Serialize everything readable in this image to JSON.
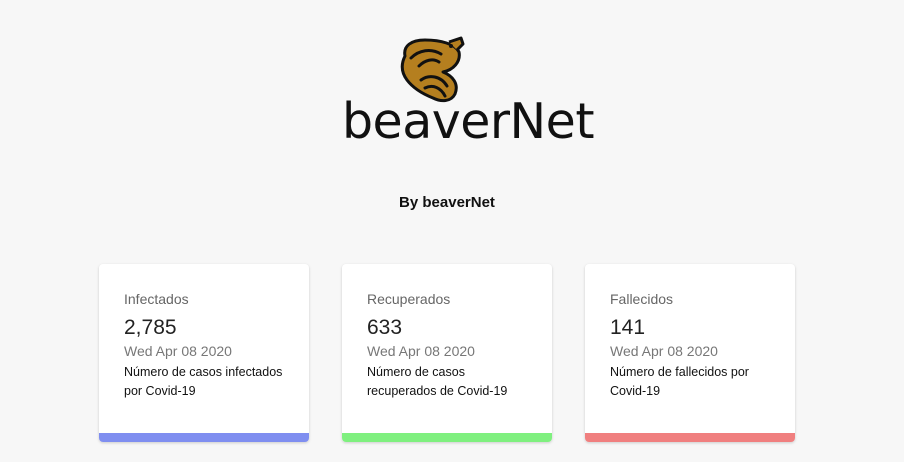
{
  "brand": {
    "title": "beaverNet",
    "byline": "By beaverNet",
    "logo_icon": "beaver-logo-icon",
    "logo_color": "#b57f1f"
  },
  "cards": [
    {
      "label": "Infectados",
      "value": "2,785",
      "date": "Wed Apr 08 2020",
      "description": "Número de casos infectados por Covid-19",
      "color": "#7f8ef0"
    },
    {
      "label": "Recuperados",
      "value": "633",
      "date": "Wed Apr 08 2020",
      "description": "Número de casos recuperados de Covid-19",
      "color": "#7ff07f"
    },
    {
      "label": "Fallecidos",
      "value": "141",
      "date": "Wed Apr 08 2020",
      "description": "Número de fallecidos por Covid-19",
      "color": "#f07f7f"
    }
  ]
}
